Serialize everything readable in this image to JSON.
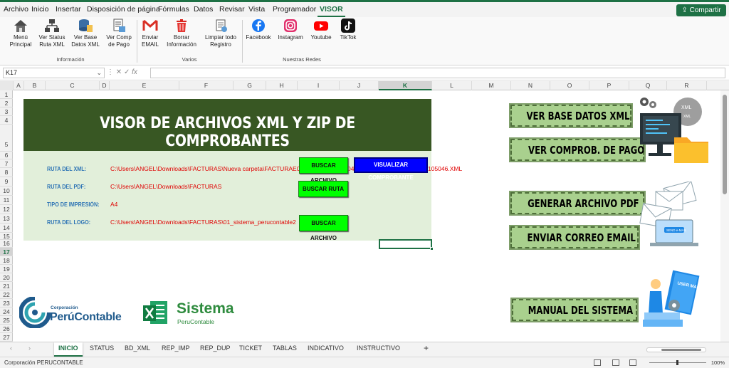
{
  "menu": {
    "tabs": [
      "Archivo",
      "Inicio",
      "Insertar",
      "Disposición de página",
      "Fórmulas",
      "Datos",
      "Revisar",
      "Vista",
      "Programador",
      "VISOR"
    ],
    "active": "VISOR",
    "share_label": "Compartir"
  },
  "ribbon": {
    "groups": [
      {
        "label": "Información",
        "buttons": [
          {
            "label": "Menú Principal",
            "icon": "house-icon"
          },
          {
            "label": "Ver Status Ruta XML",
            "icon": "network-icon"
          },
          {
            "label": "Ver Base Datos XML",
            "icon": "database-icon"
          },
          {
            "label": "Ver Comp de Pago",
            "icon": "document-icon"
          }
        ]
      },
      {
        "label": "Varios",
        "buttons": [
          {
            "label": "Enviar EMAIL",
            "icon": "gmail-icon"
          },
          {
            "label": "Borrar Información",
            "icon": "trash-icon"
          },
          {
            "label": "Limpiar todo Registro",
            "icon": "clean-icon"
          }
        ]
      },
      {
        "label": "Nuestras Redes",
        "buttons": [
          {
            "label": "Facebook",
            "icon": "facebook-icon"
          },
          {
            "label": "Instagram",
            "icon": "instagram-icon"
          },
          {
            "label": "Youtube",
            "icon": "youtube-icon"
          },
          {
            "label": "TikTok",
            "icon": "tiktok-icon"
          }
        ]
      }
    ]
  },
  "formula_bar": {
    "name_box": "K17",
    "fx": "fx",
    "formula": ""
  },
  "grid": {
    "columns": [
      "A",
      "B",
      "C",
      "D",
      "E",
      "F",
      "G",
      "H",
      "I",
      "J",
      "K",
      "L",
      "M",
      "N",
      "O",
      "P",
      "Q",
      "R"
    ],
    "selected_column": "K",
    "rows": [
      "1",
      "2",
      "3",
      "4",
      "5",
      "6",
      "7",
      "8",
      "9",
      "10",
      "11",
      "12",
      "13",
      "14",
      "15",
      "16",
      "17",
      "18",
      "19",
      "20",
      "21",
      "22",
      "23",
      "24",
      "25",
      "26",
      "27"
    ],
    "selected_row": "17"
  },
  "sheet": {
    "title": "VISOR DE ARCHIVOS XML Y ZIP DE COMPROBANTES",
    "fields": [
      {
        "label": "RUTA DEL XML:",
        "value": "C:\\Users\\ANGEL\\Downloads\\FACTURAS\\Nueva carpeta\\FACTURAE0"
      },
      {
        "label": "RUTA DEL PDF:",
        "value": "C:\\Users\\ANGEL\\Downloads\\FACTURAS"
      },
      {
        "label": "TIPO DE IMPRESIÓN:",
        "value": "A4"
      },
      {
        "label": "RUTA DEL LOGO:",
        "value": "C:\\Users\\ANGEL\\Downloads\\FACTURAS\\01_sistema_perucontable2"
      }
    ],
    "xml_overflow_text": "105046.XML",
    "xml_overflow_fragment": "04",
    "buttons": {
      "buscar_archivo_1": "BUSCAR ARCHIVO",
      "visualizar": "VISUALIZAR COMPROBANTE",
      "buscar_ruta": "BUSCAR RUTA",
      "buscar_archivo_2": "BUSCAR ARCHIVO"
    },
    "right_buttons": [
      "VER BASE DATOS XML",
      "VER COMPROB. DE PAGO",
      "GENERAR ARCHIVO PDF",
      "ENVIAR CORREO EMAIL",
      "MANUAL DEL SISTEMA"
    ],
    "illustration_text": {
      "xml_badge": "XML",
      "xml_badge_small": "XML",
      "email_button": "SEND e-MAIL",
      "manual_cover": "USER MANUAL"
    },
    "logos": {
      "corp_small": "Corporación",
      "corp_big": "PerúContable",
      "sistema": "Sistema",
      "sistema_sub": "PeruContable"
    }
  },
  "sheet_tabs": {
    "tabs": [
      "INICIO",
      "STATUS",
      "BD_XML",
      "REP_IMP",
      "REP_DUP",
      "TICKET",
      "TABLAS",
      "INDICATIVO",
      "INSTRUCTIVO"
    ],
    "active": "INICIO",
    "add": "+"
  },
  "status_bar": {
    "text": "Corporación PERUCONTABLE",
    "zoom": "100%"
  },
  "colors": {
    "excel_green": "#1e7145",
    "banner": "#385723",
    "panel": "#e2efda",
    "button_green": "#00ff00",
    "button_blue": "#0000ff",
    "right_button": "#a9d08e",
    "path_red": "#e00000",
    "label_blue": "#2f75b5"
  }
}
